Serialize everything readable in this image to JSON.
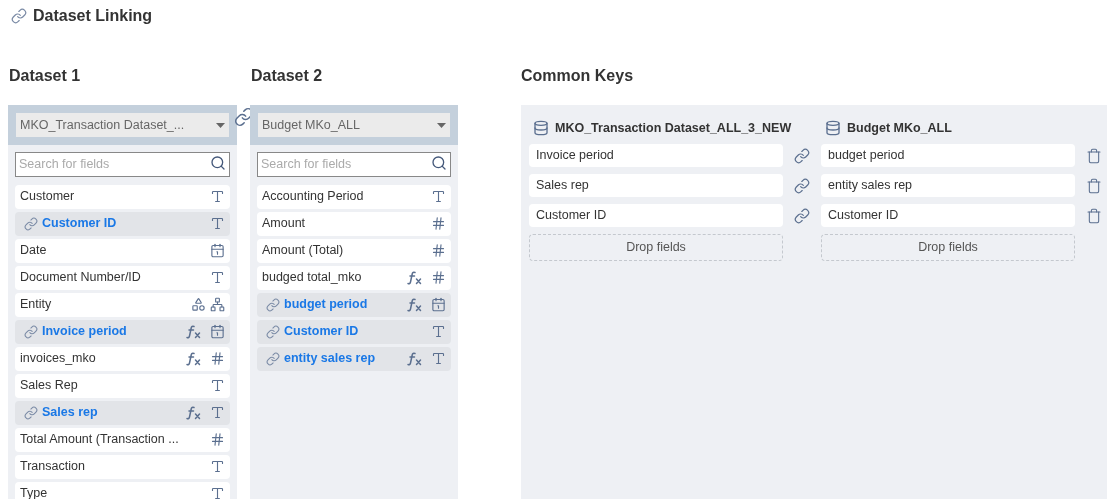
{
  "title": "Dataset Linking",
  "datasets": [
    {
      "heading": "Dataset 1",
      "selected_dataset": "MKO_Transaction Dataset_...",
      "search_placeholder": "Search for fields",
      "fields": [
        {
          "name": "Customer",
          "linked": false,
          "formula": false,
          "icons": [
            {
              "kind": "text"
            }
          ]
        },
        {
          "name": "Customer ID",
          "linked": true,
          "formula": false,
          "icons": [
            {
              "kind": "text"
            }
          ]
        },
        {
          "name": "Date",
          "linked": false,
          "formula": false,
          "icons": [
            {
              "kind": "date"
            }
          ]
        },
        {
          "name": "Document Number/ID",
          "linked": false,
          "formula": false,
          "icons": [
            {
              "kind": "text"
            }
          ]
        },
        {
          "name": "Entity",
          "linked": false,
          "formula": false,
          "icons": [
            {
              "kind": "shapes"
            },
            {
              "kind": "hierarchy"
            }
          ]
        },
        {
          "name": "Invoice period",
          "linked": true,
          "formula": true,
          "icons": [
            {
              "kind": "date"
            }
          ]
        },
        {
          "name": "invoices_mko",
          "linked": false,
          "formula": true,
          "icons": [
            {
              "kind": "number"
            }
          ]
        },
        {
          "name": "Sales Rep",
          "linked": false,
          "formula": false,
          "icons": [
            {
              "kind": "text"
            }
          ]
        },
        {
          "name": "Sales rep",
          "linked": true,
          "formula": true,
          "icons": [
            {
              "kind": "text"
            }
          ]
        },
        {
          "name": "Total Amount (Transaction ...",
          "linked": false,
          "formula": false,
          "icons": [
            {
              "kind": "number"
            }
          ]
        },
        {
          "name": "Transaction",
          "linked": false,
          "formula": false,
          "icons": [
            {
              "kind": "text"
            }
          ]
        },
        {
          "name": "Type",
          "linked": false,
          "formula": false,
          "icons": [
            {
              "kind": "text"
            }
          ]
        }
      ]
    },
    {
      "heading": "Dataset 2",
      "selected_dataset": "Budget MKo_ALL",
      "search_placeholder": "Search for fields",
      "fields": [
        {
          "name": "Accounting Period",
          "linked": false,
          "formula": false,
          "icons": [
            {
              "kind": "text"
            }
          ]
        },
        {
          "name": "Amount",
          "linked": false,
          "formula": false,
          "icons": [
            {
              "kind": "number"
            }
          ]
        },
        {
          "name": "Amount (Total)",
          "linked": false,
          "formula": false,
          "icons": [
            {
              "kind": "number"
            }
          ]
        },
        {
          "name": "budged total_mko",
          "linked": false,
          "formula": true,
          "icons": [
            {
              "kind": "number"
            }
          ]
        },
        {
          "name": "budget period",
          "linked": true,
          "formula": true,
          "icons": [
            {
              "kind": "date"
            }
          ]
        },
        {
          "name": "Customer ID",
          "linked": true,
          "formula": false,
          "icons": [
            {
              "kind": "text"
            }
          ]
        },
        {
          "name": "entity sales rep",
          "linked": true,
          "formula": true,
          "icons": [
            {
              "kind": "text"
            }
          ]
        }
      ]
    }
  ],
  "common_keys": {
    "heading": "Common Keys",
    "left_dataset": "MKO_Transaction Dataset_ALL_3_NEW",
    "right_dataset": "Budget MKo_ALL",
    "pairs": [
      {
        "left": "Invoice period",
        "right": "budget period"
      },
      {
        "left": "Sales rep",
        "right": "entity sales rep"
      },
      {
        "left": "Customer ID",
        "right": "Customer ID"
      }
    ],
    "drop_left": "Drop fields",
    "drop_right": "Drop fields"
  }
}
